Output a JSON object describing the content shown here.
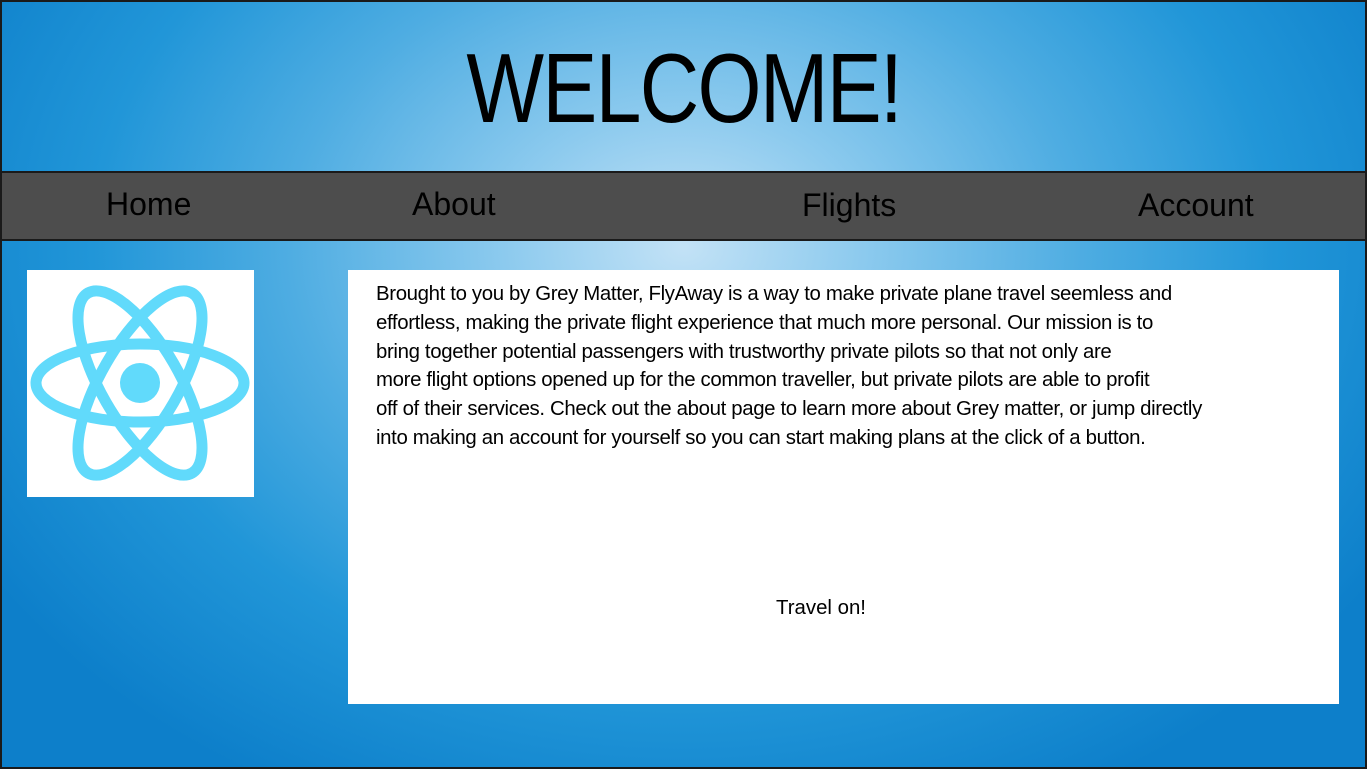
{
  "header": {
    "title": "WELCOME!"
  },
  "nav": {
    "items": [
      {
        "label": "Home"
      },
      {
        "label": "About"
      },
      {
        "label": "Flights"
      },
      {
        "label": "Account"
      }
    ]
  },
  "logo": {
    "icon": "atom-icon",
    "color": "#61dafb"
  },
  "content": {
    "intro_lines": [
      "Brought to you by Grey Matter, FlyAway is a way to make private plane travel seemless and",
      "effortless, making the private flight experience that much more personal. Our mission is to",
      "bring together potential passengers with trustworthy private pilots so that not only are",
      "more flight options opened up for the common traveller, but private pilots are able to profit",
      "off of their services. Check out the about page to learn more about Grey matter, or jump directly",
      "into making an account for yourself so you can start making plans at the click of a button."
    ],
    "signoff": "Travel on!"
  },
  "colors": {
    "background_center": "#c3e2f6",
    "background_edge": "#0d7fca",
    "nav_bar": "#4d4d4d",
    "panel": "#ffffff"
  }
}
